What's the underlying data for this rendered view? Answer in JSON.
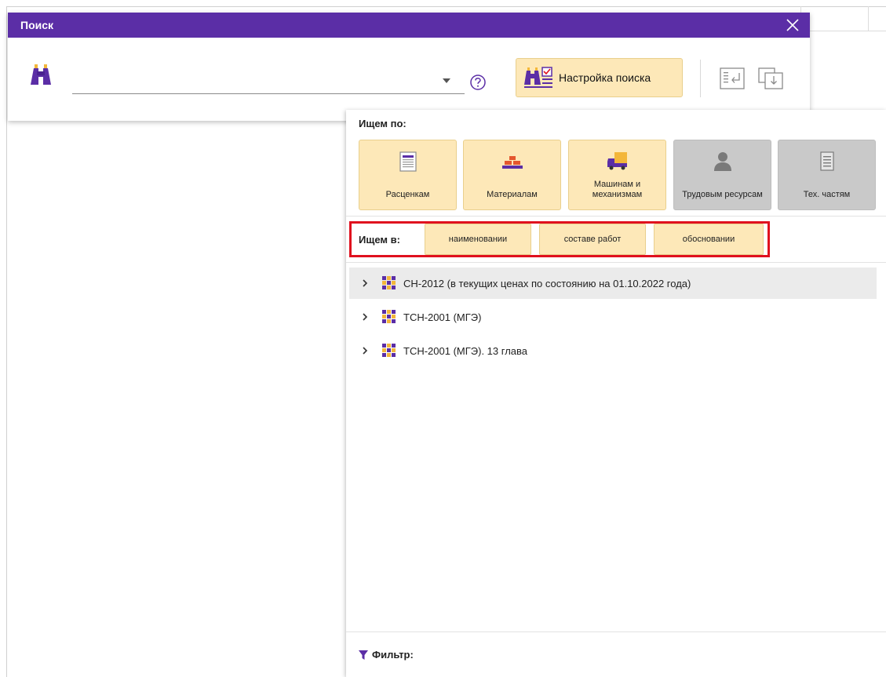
{
  "dialog": {
    "title": "Поиск",
    "search_value": "",
    "search_placeholder": "",
    "settings_button_label": "Настройка поиска"
  },
  "search_by": {
    "label": "Ищем по:",
    "categories": [
      {
        "label": "Расценкам",
        "active": true,
        "icon": "price-sheet-icon"
      },
      {
        "label": "Материалам",
        "active": true,
        "icon": "bricks-icon"
      },
      {
        "label": "Машинам и механизмам",
        "active": true,
        "icon": "truck-icon"
      },
      {
        "label": "Трудовым ресурсам",
        "active": false,
        "icon": "worker-icon"
      },
      {
        "label": "Тех. частям",
        "active": false,
        "icon": "document-icon"
      }
    ]
  },
  "search_in": {
    "label": "Ищем в:",
    "scopes": [
      "наименовании",
      "составе работ",
      "обосновании"
    ]
  },
  "tree": {
    "items": [
      {
        "label": "СН-2012 (в текущих ценах по состоянию на 01.10.2022 года)",
        "selected": true
      },
      {
        "label": "ТСН-2001 (МГЭ)",
        "selected": false
      },
      {
        "label": "ТСН-2001 (МГЭ). 13 глава",
        "selected": false
      }
    ]
  },
  "filter": {
    "label": "Фильтр:"
  },
  "colors": {
    "titlebar": "#5b2ea6",
    "active_button": "#fde8b8",
    "inactive_button": "#c9c9c9",
    "highlight": "#e0101e",
    "icon_purple": "#5b2ea6",
    "icon_gold": "#f3b63a"
  }
}
